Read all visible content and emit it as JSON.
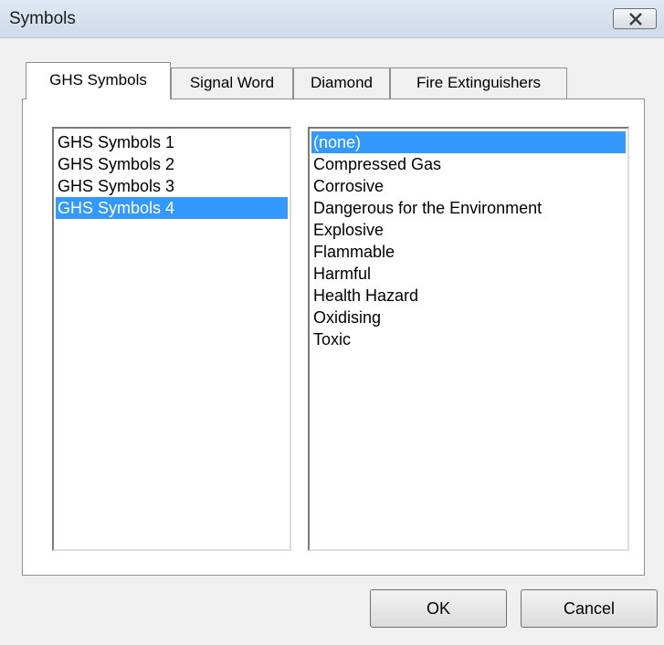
{
  "dialog": {
    "title": "Symbols"
  },
  "tabs": [
    {
      "label": "GHS Symbols",
      "active": true
    },
    {
      "label": "Signal Word",
      "active": false
    },
    {
      "label": "Diamond",
      "active": false
    },
    {
      "label": "Fire Extinguishers",
      "active": false
    }
  ],
  "set_list": {
    "items": [
      "GHS Symbols 1",
      "GHS Symbols 2",
      "GHS Symbols 3",
      "GHS Symbols 4"
    ],
    "selected": "GHS Symbols 4"
  },
  "symbol_list": {
    "items": [
      "(none)",
      "Compressed Gas",
      "Corrosive",
      "Dangerous for the Environment",
      "Explosive",
      "Flammable",
      "Harmful",
      "Health Hazard",
      "Oxidising",
      "Toxic"
    ],
    "selected": "(none)"
  },
  "buttons": {
    "ok_label": "OK",
    "cancel_label": "Cancel"
  },
  "colors": {
    "selection": "#3399ff",
    "dialog_background": "#f0f0f0"
  },
  "icons": {
    "close": "close-icon"
  }
}
